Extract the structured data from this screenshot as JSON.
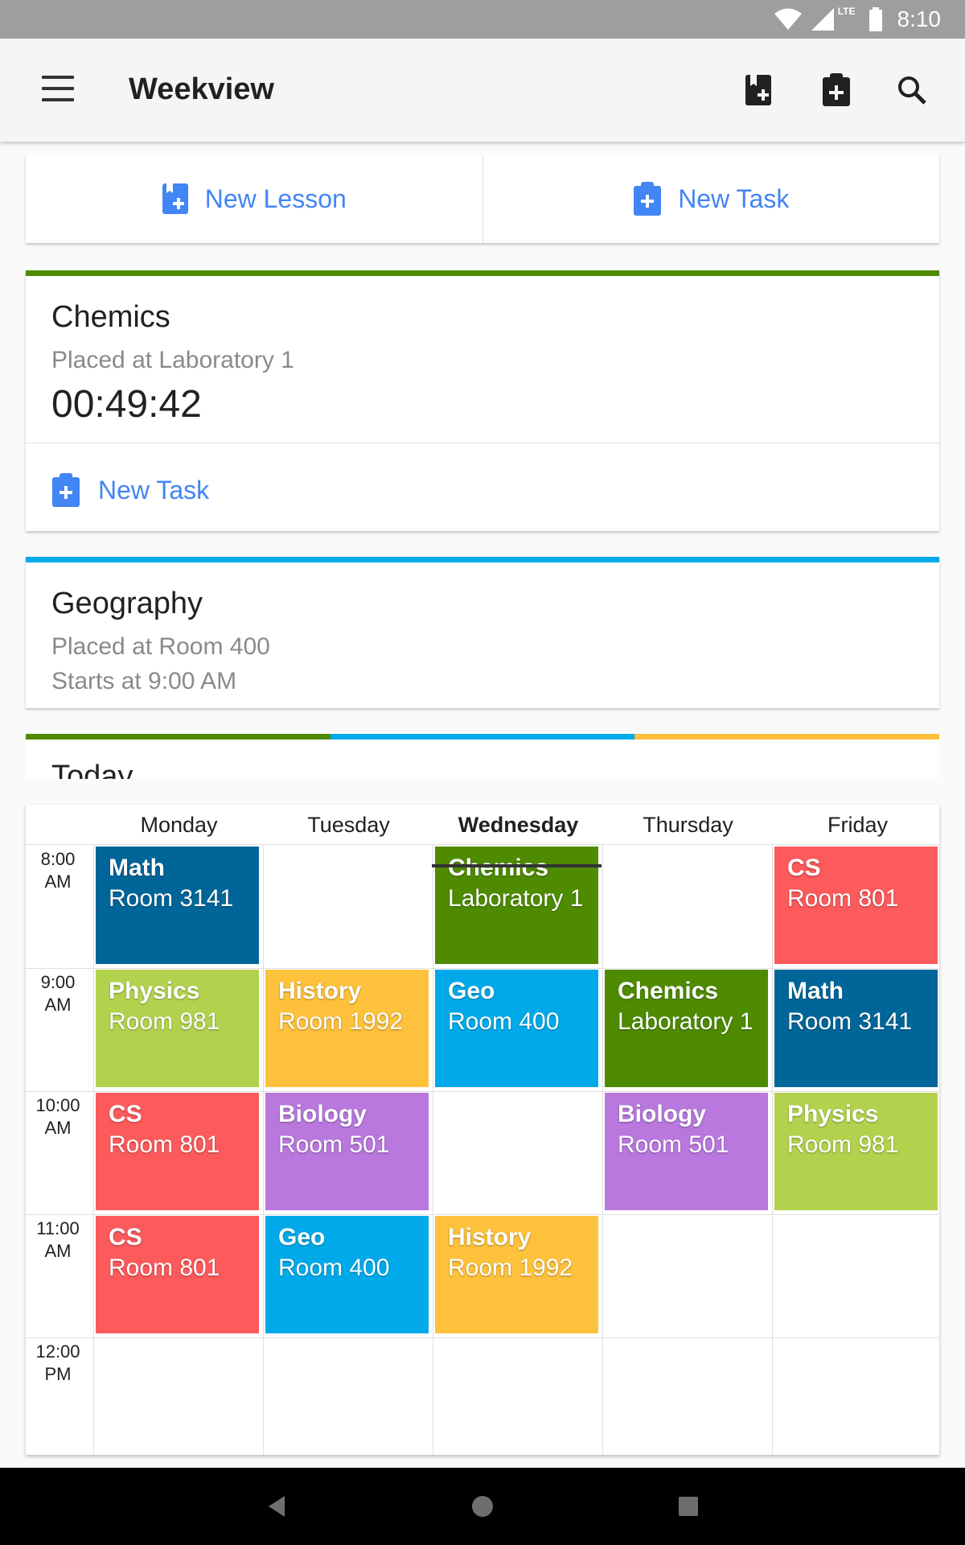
{
  "status_bar": {
    "time": "8:10",
    "network": "LTE"
  },
  "app_bar": {
    "title": "Weekview",
    "icons": [
      "menu-icon",
      "add-lesson-icon",
      "add-task-icon",
      "search-icon"
    ]
  },
  "actions": {
    "new_lesson": "New Lesson",
    "new_task": "New Task"
  },
  "current_lesson": {
    "title": "Chemics",
    "location": "Placed at Laboratory 1",
    "timer": "00:49:42",
    "new_task": "New Task",
    "color": "#4e8b00"
  },
  "next_lesson": {
    "title": "Geography",
    "location": "Placed at Room 400",
    "start": "Starts at 9:00 AM",
    "color": "#00aaea"
  },
  "today": {
    "title": "Today",
    "colors": [
      "#4e8b00",
      "#00aaea",
      "#fdc13c"
    ]
  },
  "week": {
    "days": [
      "Monday",
      "Tuesday",
      "Wednesday",
      "Thursday",
      "Friday"
    ],
    "active_day": "Wednesday",
    "times": [
      "8:00\nAM",
      "9:00\nAM",
      "10:00\nAM",
      "11:00\nAM",
      "12:00\nPM"
    ],
    "lessons": [
      {
        "day": 0,
        "slot": 0,
        "name": "Math",
        "room": "Room 3141",
        "color": "#006699"
      },
      {
        "day": 2,
        "slot": 0,
        "name": "Chemics",
        "room": "Laboratory 1",
        "color": "#4e8b00"
      },
      {
        "day": 4,
        "slot": 0,
        "name": "CS",
        "room": "Room 801",
        "color": "#fd5a5c"
      },
      {
        "day": 0,
        "slot": 1,
        "name": "Physics",
        "room": "Room 981",
        "color": "#b2d24e"
      },
      {
        "day": 1,
        "slot": 1,
        "name": "History",
        "room": "Room 1992",
        "color": "#fdc13c"
      },
      {
        "day": 2,
        "slot": 1,
        "name": "Geo",
        "room": "Room 400",
        "color": "#00aaea"
      },
      {
        "day": 3,
        "slot": 1,
        "name": "Chemics",
        "room": "Laboratory 1",
        "color": "#4e8b00"
      },
      {
        "day": 4,
        "slot": 1,
        "name": "Math",
        "room": "Room 3141",
        "color": "#006699"
      },
      {
        "day": 0,
        "slot": 2,
        "name": "CS",
        "room": "Room 801",
        "color": "#fd5a5c"
      },
      {
        "day": 1,
        "slot": 2,
        "name": "Biology",
        "room": "Room 501",
        "color": "#b878de"
      },
      {
        "day": 3,
        "slot": 2,
        "name": "Biology",
        "room": "Room 501",
        "color": "#b878de"
      },
      {
        "day": 4,
        "slot": 2,
        "name": "Physics",
        "room": "Room 981",
        "color": "#b2d24e"
      },
      {
        "day": 0,
        "slot": 3,
        "name": "CS",
        "room": "Room 801",
        "color": "#fd5a5c"
      },
      {
        "day": 1,
        "slot": 3,
        "name": "Geo",
        "room": "Room 400",
        "color": "#00aaea"
      },
      {
        "day": 2,
        "slot": 3,
        "name": "History",
        "room": "Room 1992",
        "color": "#fdc13c"
      }
    ]
  },
  "nav_bar": {
    "icons": [
      "back-icon",
      "home-icon",
      "recents-icon"
    ]
  }
}
